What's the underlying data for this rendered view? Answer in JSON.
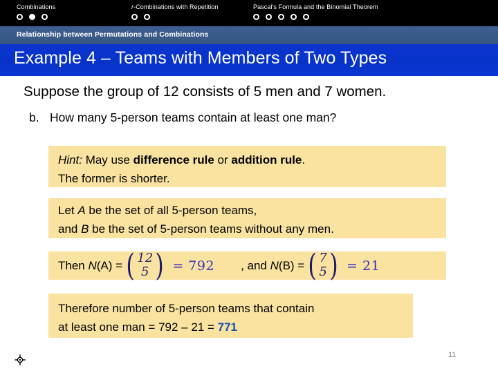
{
  "top_nav": {
    "groups": [
      {
        "label_prefix": "",
        "label": "Combinations",
        "dots": [
          "hollow",
          "filled",
          "hollow"
        ]
      },
      {
        "label_prefix": "r",
        "label": "-Combinations with Repetition",
        "dots": [
          "hollow",
          "hollow"
        ]
      },
      {
        "label_prefix": "",
        "label": "Pascal's Formula and the Binomial Theorem",
        "dots": [
          "hollow",
          "hollow",
          "hollow",
          "hollow",
          "hollow"
        ]
      }
    ]
  },
  "subheader": {
    "text": "Relationship between Permutations and Combinations",
    "color": "#3a5a8c"
  },
  "title": {
    "text": "Example 4 – Teams with Members of Two Types",
    "color": "#0a34cc"
  },
  "body": {
    "prompt": "Suppose the group of 12 consists of 5 men and 7 women.",
    "question_label": "b.",
    "question_text": "How many 5-person teams contain at least one man?"
  },
  "hint_box": {
    "bg": "#fae3a1",
    "line1_italic": "Hint:",
    "line1_a": " May use ",
    "line1_bold1": "difference rule",
    "line1_b": " or ",
    "line1_bold2": "addition rule",
    "line1_c": ".",
    "line2": "The former is shorter."
  },
  "set_box": {
    "bg": "#fae3a1",
    "line1_a": "Let ",
    "line1_var": "A",
    "line1_b": " be the set of all 5-person teams,",
    "line2_a": "and ",
    "line2_var": "B",
    "line2_b": " be the set of 5-person teams without any men."
  },
  "formula_box": {
    "bg": "#fae3a1",
    "lead": "Then ",
    "n_label_a": "N",
    "n_arg_a": "(A)",
    "eq_a": " = ",
    "binom_a_top": "12",
    "binom_a_bottom": "5",
    "binom_a_eq": "= 792",
    "middle": ", and ",
    "n_label_b": "N",
    "n_arg_b": "(B)",
    "eq_b": " = ",
    "binom_b_top": "7",
    "binom_b_bottom": "5",
    "binom_b_eq": "= 21",
    "binom_color": "#1f1b6e",
    "value_color": "#3730c0"
  },
  "result_box": {
    "bg": "#fae3a1",
    "line1": "Therefore number of 5-person teams that contain",
    "line2_a": "at least one man =  792 – 21 = ",
    "line2_answer": "771",
    "answer_color": "#1450b4"
  },
  "footer": {
    "page_number": "11",
    "icon": "crosshair-target-icon"
  }
}
